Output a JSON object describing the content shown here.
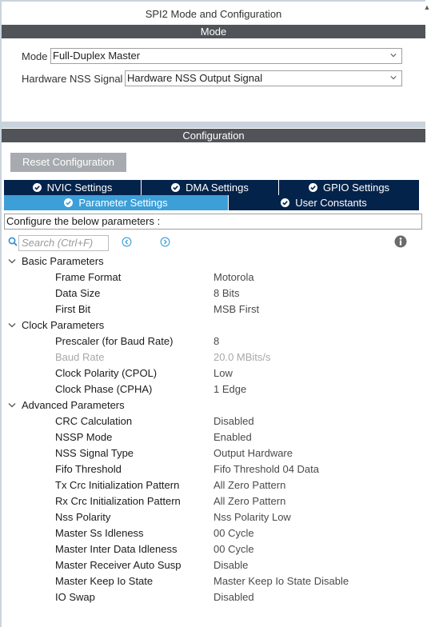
{
  "window": {
    "title": "SPI2 Mode and Configuration"
  },
  "mode_section": {
    "header": "Mode",
    "mode": {
      "label": "Mode",
      "value": "Full-Duplex Master"
    },
    "nss": {
      "label": "Hardware NSS Signal",
      "value": "Hardware NSS Output Signal"
    }
  },
  "config_section": {
    "header": "Configuration",
    "reset_label": "Reset Configuration",
    "tabs": [
      {
        "label": "NVIC Settings",
        "active": false
      },
      {
        "label": "DMA Settings",
        "active": false
      },
      {
        "label": "GPIO Settings",
        "active": false
      },
      {
        "label": "Parameter Settings",
        "active": true
      },
      {
        "label": "User Constants",
        "active": false
      }
    ],
    "description": "Configure the below parameters :",
    "search": {
      "placeholder": "Search (Ctrl+F)"
    },
    "groups": [
      {
        "name": "Basic Parameters",
        "params": [
          {
            "name": "Frame Format",
            "value": "Motorola"
          },
          {
            "name": "Data Size",
            "value": "8 Bits"
          },
          {
            "name": "First Bit",
            "value": "MSB First"
          }
        ]
      },
      {
        "name": "Clock Parameters",
        "params": [
          {
            "name": "Prescaler (for Baud Rate)",
            "value": "8"
          },
          {
            "name": "Baud Rate",
            "value": "20.0 MBits/s",
            "disabled": true
          },
          {
            "name": "Clock Polarity (CPOL)",
            "value": "Low"
          },
          {
            "name": "Clock Phase (CPHA)",
            "value": "1 Edge"
          }
        ]
      },
      {
        "name": "Advanced Parameters",
        "params": [
          {
            "name": "CRC Calculation",
            "value": "Disabled"
          },
          {
            "name": "NSSP Mode",
            "value": "Enabled"
          },
          {
            "name": "NSS Signal Type",
            "value": "Output Hardware"
          },
          {
            "name": "Fifo Threshold",
            "value": "Fifo Threshold 04 Data"
          },
          {
            "name": "Tx Crc Initialization Pattern",
            "value": "All Zero Pattern"
          },
          {
            "name": "Rx Crc Initialization Pattern",
            "value": "All Zero Pattern"
          },
          {
            "name": "Nss Polarity",
            "value": "Nss Polarity Low"
          },
          {
            "name": "Master Ss Idleness",
            "value": "00 Cycle"
          },
          {
            "name": "Master Inter Data Idleness",
            "value": "00 Cycle"
          },
          {
            "name": "Master Receiver Auto Susp",
            "value": "Disable"
          },
          {
            "name": "Master Keep Io State",
            "value": "Master Keep Io State Disable"
          },
          {
            "name": "IO Swap",
            "value": "Disabled"
          }
        ]
      }
    ]
  },
  "colors": {
    "header_bar": "#505358",
    "tab_dark": "#03234b",
    "tab_active": "#3c9fd8",
    "reset_button": "#a7abaf",
    "background": "#c9d3dd"
  },
  "icons": [
    "chevron-down-icon",
    "check-circle-icon",
    "search-icon",
    "previous-icon",
    "next-icon",
    "info-icon",
    "collapse-icon"
  ]
}
